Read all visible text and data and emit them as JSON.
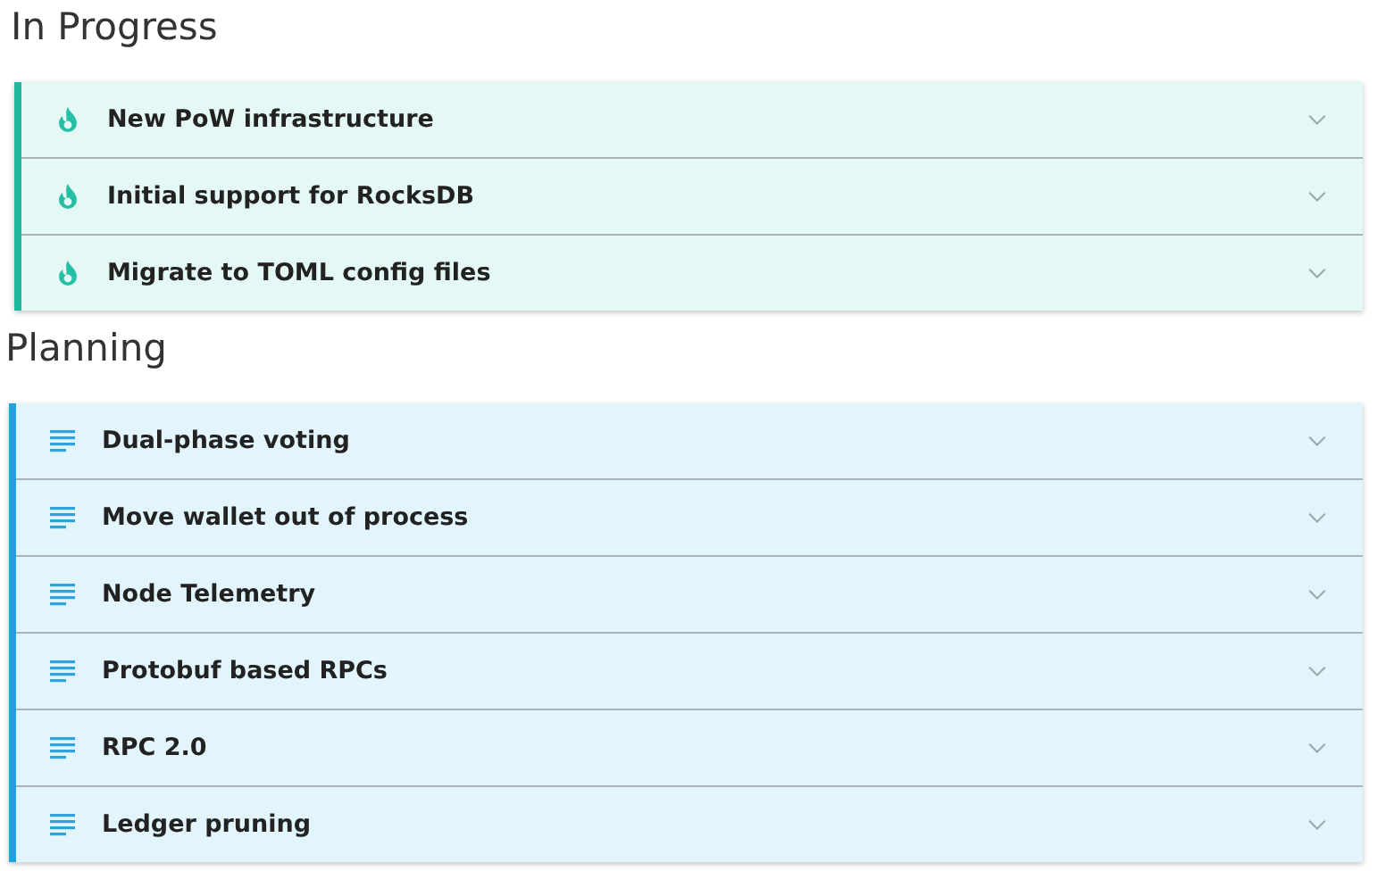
{
  "sections": [
    {
      "title": "In Progress",
      "kind": "flame",
      "items": [
        {
          "label": "New PoW infrastructure",
          "expanded": false
        },
        {
          "label": "Initial support for RocksDB",
          "expanded": false
        },
        {
          "label": "Migrate to TOML config files",
          "expanded": false
        }
      ]
    },
    {
      "title": "Planning",
      "kind": "list",
      "items": [
        {
          "label": "Dual-phase voting",
          "expanded": false
        },
        {
          "label": "Move wallet out of process",
          "expanded": false
        },
        {
          "label": "Node Telemetry",
          "expanded": false
        },
        {
          "label": "Protobuf based RPCs",
          "expanded": false
        },
        {
          "label": "RPC 2.0",
          "expanded": false
        },
        {
          "label": "Ledger pruning",
          "expanded": false
        }
      ]
    }
  ]
}
